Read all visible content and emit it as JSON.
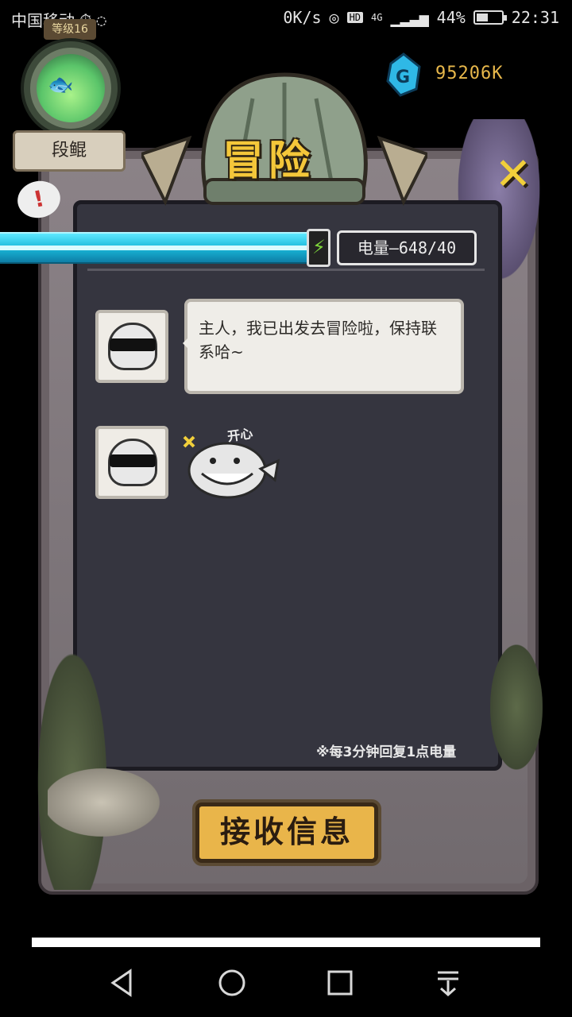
{
  "status_bar": {
    "carrier": "中国移动",
    "net_speed": "0K/s",
    "hd": "HD",
    "network": "4G",
    "battery": "44%",
    "time": "22:31"
  },
  "player": {
    "level": "等级16",
    "name": "段鲲"
  },
  "currency": {
    "amount": "95206K",
    "icon": "gem-g-icon"
  },
  "page": {
    "title": "冒险",
    "header_text": "..."
  },
  "energy": {
    "label": "电量—648/40",
    "fill": 1.0
  },
  "messages": [
    {
      "text": "主人，我已出发去冒险啦，保持联系哈~"
    },
    {
      "sticker_text": "开心"
    }
  ],
  "regen_note": "※每3分钟回复1点电量",
  "receive_button_label": "接收信息",
  "colors": {
    "accent": "#f4c73a",
    "energy": "#19b9da",
    "board": "#35353f"
  }
}
